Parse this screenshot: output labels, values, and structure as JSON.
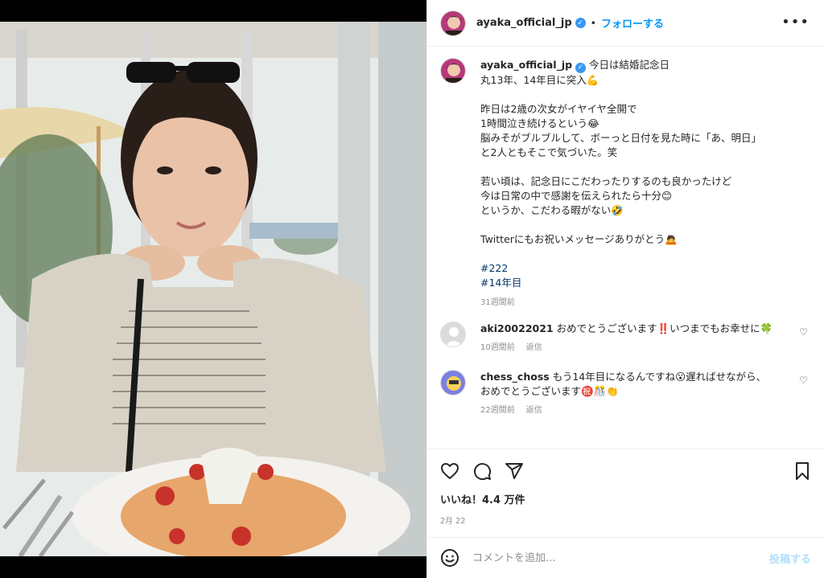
{
  "post": {
    "username": "ayaka_official_jp",
    "follow_label": "フォローする",
    "dot": "•",
    "more_icon": "more-horizontal-icon"
  },
  "caption": {
    "username": "ayaka_official_jp",
    "lines": [
      "今日は結婚記念日",
      "丸13年、14年目に突入💪",
      "",
      "昨日は2歳の次女がイヤイヤ全開で",
      "1時間泣き続けるという😂",
      "脳みそがブルブルして、ボーっと日付を見た時に「あ、明日」",
      "と2人ともそこで気づいた。笑",
      "",
      "若い頃は、記念日にこだわったりするのも良かったけど",
      "今は日常の中で感謝を伝えられたら十分😊",
      "というか、こだわる暇がない🤣",
      "",
      "Twitterにもお祝いメッセージありがとう🙇"
    ],
    "hashtags": [
      "#222",
      "#14年目"
    ],
    "time": "31週間前"
  },
  "comments": [
    {
      "username": "aki20022021",
      "text": "おめでとうございます‼️いつまでもお幸せに🍀",
      "time": "10週間前",
      "reply": "返信"
    },
    {
      "username": "chess_choss",
      "text": "もう14年目になるんですね😮遅ればせながら、",
      "text2": "おめでとうございます㊗️🎊👏",
      "time": "22週間前",
      "reply": "返信"
    }
  ],
  "stats": {
    "likes": "いいね！4.4 万件",
    "date": "2月 22"
  },
  "comment_box": {
    "placeholder": "コメントを追加...",
    "post_label": "投稿する"
  },
  "colors": {
    "link": "#0095f6",
    "hashtag": "#00376b",
    "muted": "#8e8e8e",
    "post_disabled": "#b2dffc"
  }
}
